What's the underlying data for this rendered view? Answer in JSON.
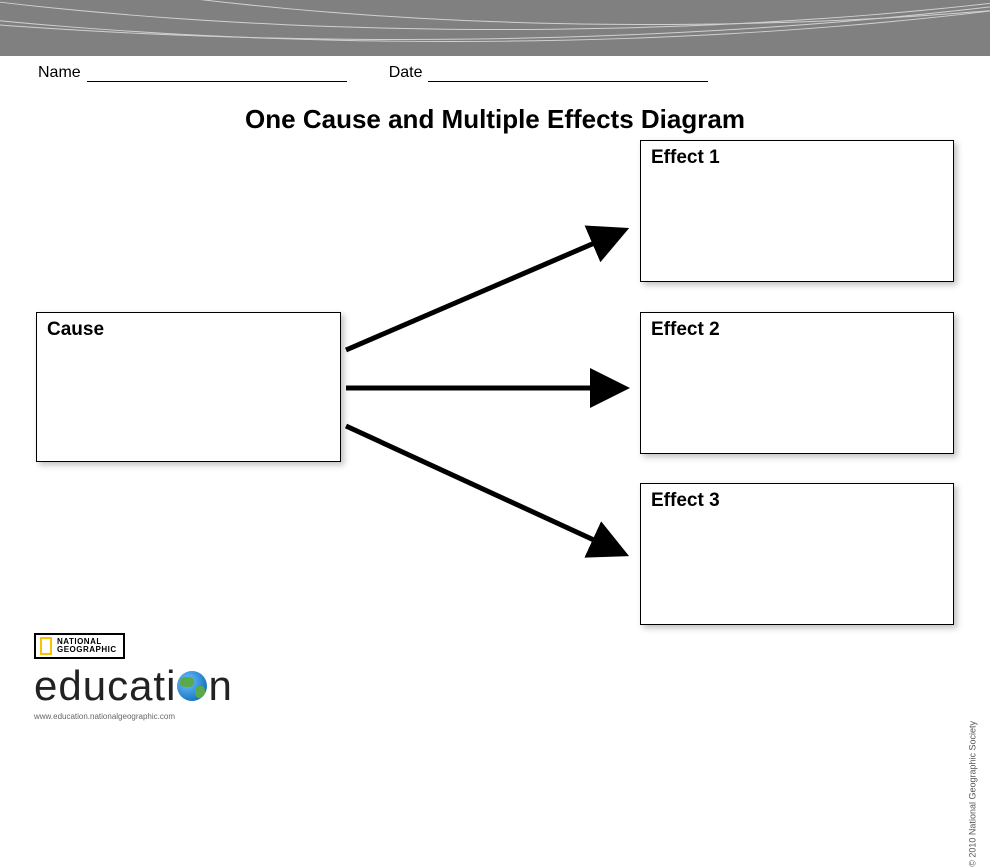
{
  "form": {
    "name_label": "Name",
    "date_label": "Date"
  },
  "title": "One Cause and Multiple Effects Diagram",
  "boxes": {
    "cause": "Cause",
    "effect1": "Effect 1",
    "effect2": "Effect 2",
    "effect3": "Effect 3"
  },
  "footer": {
    "brand_top": "NATIONAL",
    "brand_bottom": "GEOGRAPHIC",
    "edu_prefix": "educati",
    "edu_suffix": "n",
    "url": "www.education.nationalgeographic.com",
    "copyright": "© 2010 National Geographic Society"
  }
}
